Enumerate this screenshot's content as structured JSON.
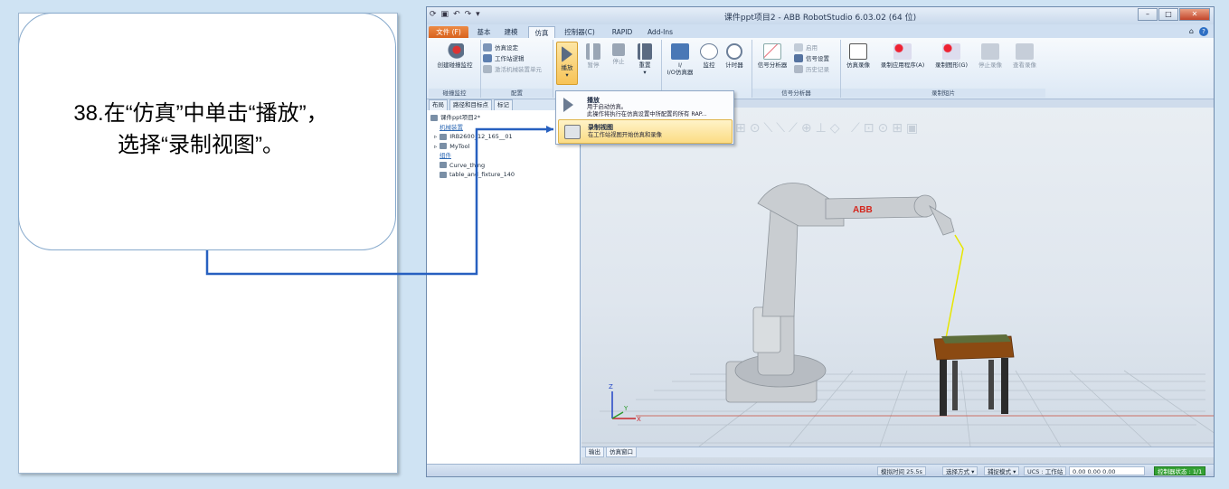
{
  "slide": {
    "instruction_line1": "38.在“仿真”中单击“播放”，",
    "instruction_line2": "选择“录制视图”。"
  },
  "window": {
    "title": "课件ppt项目2 - ABB RobotStudio 6.03.02 (64 位)",
    "minimize": "–",
    "maximize": "□",
    "close": "✕"
  },
  "tabs": [
    {
      "label": "文件 (F)"
    },
    {
      "label": "基本"
    },
    {
      "label": "建模"
    },
    {
      "label": "仿真"
    },
    {
      "label": "控制器(C)"
    },
    {
      "label": "RAPID"
    },
    {
      "label": "Add-Ins"
    }
  ],
  "ribbon": {
    "collision": {
      "button": "创建碰撞监控",
      "group": "碰撞监控"
    },
    "config": {
      "sim_setup": "仿真设定",
      "station_logic": "工作站逻辑",
      "activate_mech": "激活机械装置单元",
      "group": "配置"
    },
    "control": {
      "play": "播放",
      "pause": "暂停",
      "stop": "停止",
      "reset": "重置"
    },
    "monitor": {
      "io_sim": "I/O仿真器",
      "io_top": "I/",
      "monitor": "监控",
      "timer": "计时器"
    },
    "signal": {
      "analyzer": "信号分析器",
      "enable": "启用",
      "settings": "信号设置",
      "history": "历史记录",
      "group": "信号分析器"
    },
    "record": {
      "record_sim": "仿真录像",
      "record_app": "录制应用程序(A)",
      "record_graphics": "录制图形(G)",
      "stop_record": "停止录像",
      "view_record": "查看录像",
      "group": "录制短片"
    }
  },
  "dropdown": {
    "play_title": "播放",
    "play_desc1": "用于启动仿真。",
    "play_desc2": "此操作将执行在仿真设置中所配置的所有 RAP...",
    "record_title": "录制视图",
    "record_desc": "在工作站视图开始仿真和录像"
  },
  "left_pane": {
    "tabs": [
      "布局",
      "路径和目标点",
      "标记"
    ],
    "root": "课件ppt项目2*",
    "category_mech": "机械装置",
    "robot": "IRB2600_12_165__01",
    "tool": "MyTool",
    "category_parts": "组件",
    "part1": "Curve_thing",
    "part2": "table_and_fixture_140"
  },
  "output_tabs": [
    "输出",
    "仿真窗口"
  ],
  "status": {
    "sim_time": "模拟时间 25.5s",
    "select_mode": "选择方式 ▾",
    "snap_mode": "捕捉模式 ▾",
    "ucs": "UCS : 工作站",
    "coords": "0.00  0.00  0.00",
    "controller": "控制器状态 :  1/1"
  },
  "axes": {
    "x": "X",
    "y": "Y",
    "z": "Z"
  },
  "colors": {
    "file_tab": "#d8631e",
    "robot_body": "#c9cdd1",
    "abb_red": "#d4261d",
    "table_top": "#8b4a12",
    "status_green": "#34a134"
  }
}
